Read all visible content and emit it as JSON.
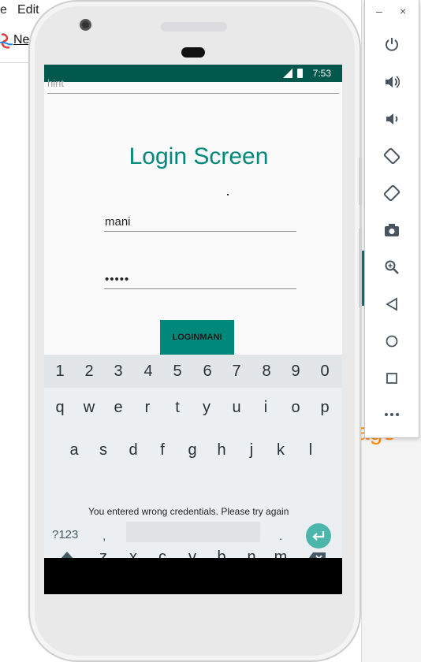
{
  "host": {
    "menu_e": "e",
    "menu_edit": "Edit",
    "toolbar_new": "Ne",
    "orange_text": "age"
  },
  "emulator_panel": {
    "minimize": "–",
    "close": "×",
    "buttons": [
      "power-icon",
      "volume-up-icon",
      "volume-down-icon",
      "rotate-left-icon",
      "rotate-right-icon",
      "camera-icon",
      "zoom-icon",
      "back-icon",
      "home-icon",
      "overview-icon",
      "more-icon"
    ]
  },
  "status_bar": {
    "time": "7:53"
  },
  "app": {
    "hint": "hint",
    "title": "Login Screen",
    "username_value": "mani",
    "password_value": "•••••",
    "login_button": "LOGINMANI",
    "accent_color": "#00897b"
  },
  "keyboard": {
    "numbers": [
      "1",
      "2",
      "3",
      "4",
      "5",
      "6",
      "7",
      "8",
      "9",
      "0"
    ],
    "row1": [
      "q",
      "w",
      "e",
      "r",
      "t",
      "y",
      "u",
      "i",
      "o",
      "p"
    ],
    "row2": [
      "a",
      "s",
      "d",
      "f",
      "g",
      "h",
      "j",
      "k",
      "l"
    ],
    "row3": [
      "z",
      "x",
      "c",
      "v",
      "b",
      "n",
      "m"
    ],
    "symbols_key": "?123",
    "comma_key": ",",
    "period_key": "."
  },
  "toast": {
    "message": "You entered wrong credentials. Please try again"
  }
}
